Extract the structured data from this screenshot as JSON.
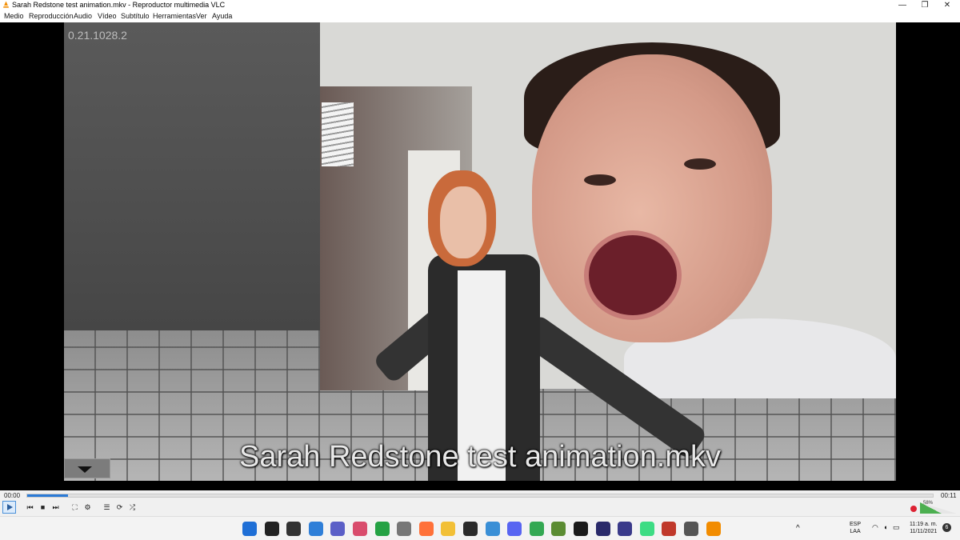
{
  "window": {
    "title": "Sarah Redstone test animation.mkv - Reproductor multimedia VLC",
    "minimize": "—",
    "restore": "❐",
    "close": "✕"
  },
  "menu": [
    "Medio",
    "Reproducción",
    "Audio",
    "Vídeo",
    "Subtítulo",
    "Herramientas",
    "Ver",
    "Ayuda"
  ],
  "video": {
    "overlay_version": "0.21.1028.2",
    "subtitle": "Sarah Redstone test animation.mkv"
  },
  "player": {
    "elapsed": "00:00",
    "duration": "00:11",
    "progress_fraction": 0.045,
    "volume_label": "58%",
    "volume_fraction": 0.58
  },
  "controls": {
    "prev": "⏮",
    "stop": "■",
    "next": "⏭",
    "fullscreen": "⛶",
    "extended": "⚙",
    "playlist": "☰",
    "loop": "⟳",
    "random": "⤮"
  },
  "taskbar": {
    "apps": [
      {
        "name": "start-icon",
        "color": "#1f6fd6"
      },
      {
        "name": "search-icon",
        "color": "#222222"
      },
      {
        "name": "task-view-icon",
        "color": "#333333"
      },
      {
        "name": "widgets-icon",
        "color": "#2f7fd8"
      },
      {
        "name": "chat-icon",
        "color": "#5b5fc7"
      },
      {
        "name": "snip-icon",
        "color": "#d94c6c"
      },
      {
        "name": "whatsapp-icon",
        "color": "#25a244"
      },
      {
        "name": "mouse-icon",
        "color": "#777777"
      },
      {
        "name": "firefox-icon",
        "color": "#ff7139"
      },
      {
        "name": "explorer-icon",
        "color": "#f2c037"
      },
      {
        "name": "obs-icon",
        "color": "#2b2b2b"
      },
      {
        "name": "notepad-icon",
        "color": "#3a8fd6"
      },
      {
        "name": "discord-icon",
        "color": "#5865f2"
      },
      {
        "name": "chrome-icon",
        "color": "#34a853"
      },
      {
        "name": "minecraft-icon",
        "color": "#5b8c32"
      },
      {
        "name": "epic-icon",
        "color": "#1a1a1a"
      },
      {
        "name": "clip-icon",
        "color": "#2a2a6a"
      },
      {
        "name": "blender-icon",
        "color": "#3a3a8a"
      },
      {
        "name": "android-icon",
        "color": "#3ddc84"
      },
      {
        "name": "puzzle-icon",
        "color": "#c0392b"
      },
      {
        "name": "box-icon",
        "color": "#555555"
      },
      {
        "name": "vlc-icon",
        "color": "#f28c00"
      }
    ],
    "tray": {
      "lang_1": "ESP",
      "lang_2": "LAA",
      "time": "11:19 a. m.",
      "date": "11/11/2021",
      "notifications": "6"
    }
  }
}
